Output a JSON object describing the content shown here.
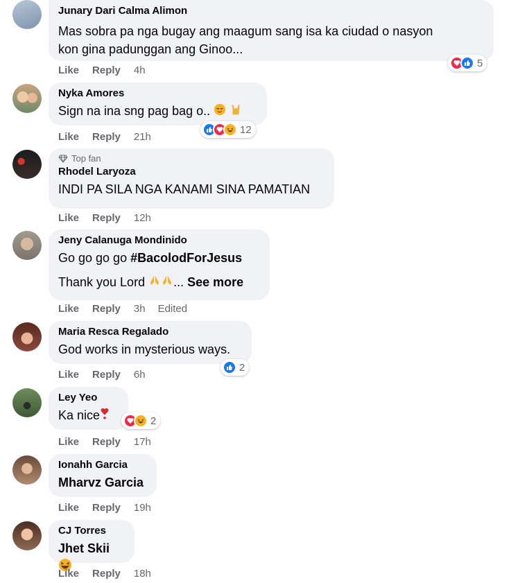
{
  "labels": {
    "like": "Like",
    "reply": "Reply",
    "top_fan": "Top fan",
    "edited": "Edited",
    "see_more": "See more"
  },
  "comments": [
    {
      "name": "Junary Dari Calma Alimon",
      "text": "Mas sobra pa nga bugay ang maagum sang isa ka ciudad o nasyon kon gina padunggan ang Ginoo...",
      "text_line1": "Mas sobra pa nga bugay ang maagum sang isa ka ciudad o nasyon",
      "text_line2": "kon gina padunggan ang Ginoo...",
      "time": "4h",
      "reactions": [
        "love",
        "like"
      ],
      "reaction_count": "5"
    },
    {
      "name": "Nyka Amores",
      "text": "Sign na ina sng pag bag o..",
      "time": "21h",
      "reactions": [
        "like",
        "love",
        "haha"
      ],
      "reaction_count": "12"
    },
    {
      "name": "Rhodel Laryoza",
      "badge": "Top fan",
      "text": "INDI PA SILA NGA KANAMI SINA PAMATIAN",
      "time": "12h"
    },
    {
      "name": "Jeny Calanuga Mondinido",
      "text_line1_prefix": "Go go go go ",
      "hashtag": "#BacolodForJesus",
      "text_line2_prefix": "Thank you Lord",
      "text_line2_suffix": "...",
      "time": "3h"
    },
    {
      "name": "Maria Resca Regalado",
      "text": "God works in mysterious ways.",
      "time": "6h",
      "reactions": [
        "like"
      ],
      "reaction_count": "2"
    },
    {
      "name": "Ley Yeo",
      "text": "Ka nice",
      "time": "17h",
      "reactions": [
        "love",
        "haha"
      ],
      "reaction_count": "2"
    },
    {
      "name": "Ionahh Garcia",
      "text": "Mharvz Garcia",
      "time": "19h"
    },
    {
      "name": "CJ Torres",
      "text": "Jhet Skii",
      "time": "18h"
    }
  ],
  "colors": {
    "like": "#1877f2",
    "love": "#f02849",
    "haha": "#f7b125",
    "bubble": "#f0f2f5",
    "meta": "#65676b"
  }
}
